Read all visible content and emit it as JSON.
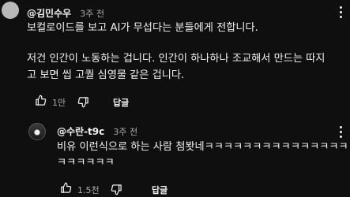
{
  "top_comment": {
    "author": "@김민수우",
    "time": "3주 전",
    "lines": [
      "보컬로이드를 보고 AI가 무섭다는 분들에게 전합니다.",
      "저건 인간이 노동하는 겁니다. 인간이 하나하나 조교해서 만드는 따지",
      "고 보면 씹 고퀄 심영물 같은 겁니다."
    ],
    "like_count": "1만",
    "reply_label": "답글"
  },
  "reply_comment": {
    "author": "@수란-t9c",
    "time": "3주 전",
    "lines": [
      "비유 이런식으로 하는 사람 첨봣네ㅋㅋㅋㅋㅋㅋㅋㅋㅋㅋㅋㅋㅋㅋㅋㅋ",
      "ㅋㅋㅋㅋㅋㅋ"
    ],
    "like_count": "1.5천",
    "reply_label": "답글"
  },
  "icons": {
    "like": "thumbs-up-icon",
    "dislike": "thumbs-down-icon",
    "more": "more-vertical-icon"
  }
}
